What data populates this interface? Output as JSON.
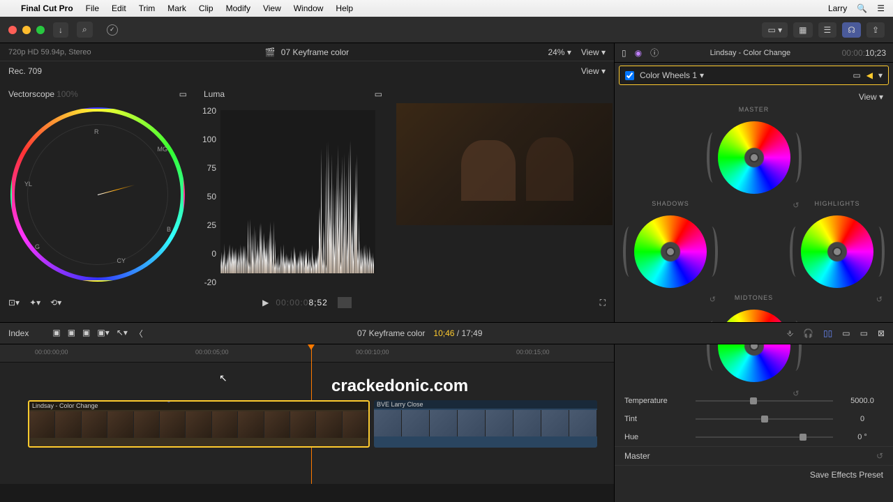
{
  "menubar": {
    "app": "Final Cut Pro",
    "items": [
      "File",
      "Edit",
      "Trim",
      "Mark",
      "Clip",
      "Modify",
      "View",
      "Window",
      "Help"
    ],
    "user": "Larry"
  },
  "toolbar": {
    "import_icon": "↓",
    "key_icon": "⌕",
    "check_icon": "✓"
  },
  "viewer": {
    "format": "720p HD 59.94p, Stereo",
    "clip_name": "07 Keyframe color",
    "zoom": "24%",
    "view_btn": "View",
    "colorspace": "Rec. 709",
    "view_btn2": "View"
  },
  "scopes": {
    "vectorscope": {
      "title": "Vectorscope",
      "pct": "100%",
      "labels": [
        "R",
        "MG",
        "B",
        "CY",
        "G",
        "YL"
      ]
    },
    "luma": {
      "title": "Luma",
      "ticks": [
        "120",
        "100",
        "75",
        "50",
        "25",
        "0",
        "-20"
      ]
    }
  },
  "transport": {
    "tc_prefix": "00:00:0",
    "tc_main": "8;52"
  },
  "timeline": {
    "index_btn": "Index",
    "name": "07 Keyframe color",
    "pos": "10;46",
    "dur": "17;49",
    "ruler": [
      "00:00:00;00",
      "00:00:05;00",
      "00:00:10;00",
      "00:00:15;00"
    ],
    "clip1": "Lindsay - Color Change",
    "clip2": "BVE Larry Close"
  },
  "inspector": {
    "clip": "Lindsay - Color Change",
    "tc_pre": "00:00:",
    "tc": "10;23",
    "effect": "Color Wheels 1",
    "view": "View",
    "wheels": {
      "master": "MASTER",
      "shadows": "SHADOWS",
      "highlights": "HIGHLIGHTS",
      "midtones": "MIDTONES"
    },
    "sliders": [
      {
        "label": "Temperature",
        "value": "5000.0",
        "pos": 42
      },
      {
        "label": "Tint",
        "value": "0",
        "pos": 50
      },
      {
        "label": "Hue",
        "value": "0 °",
        "pos": 78
      }
    ],
    "master_row": "Master",
    "save": "Save Effects Preset"
  },
  "watermark": "crackedonic.com"
}
